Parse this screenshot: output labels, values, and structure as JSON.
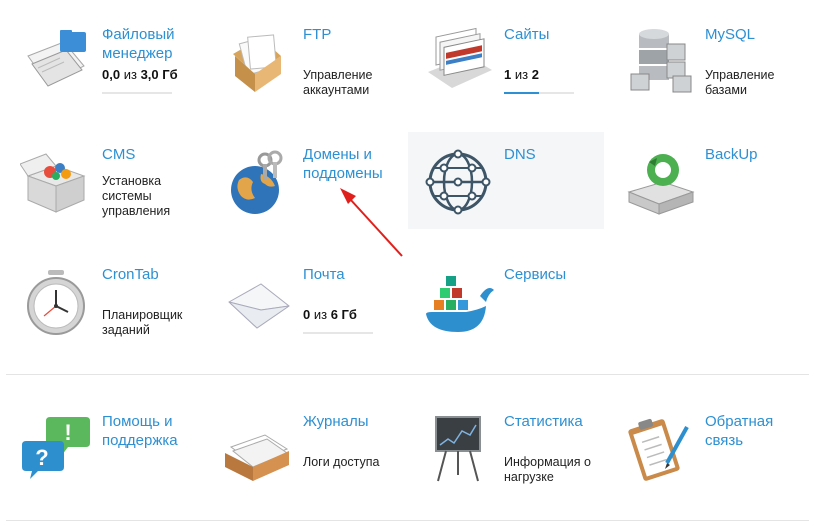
{
  "tiles": {
    "files": {
      "title": "Файловый менеджер",
      "used": "0,0",
      "sep": "из",
      "total": "3,0 Гб",
      "usage_fraction": 0.0
    },
    "ftp": {
      "title": "FTP",
      "desc": "Управление аккаунтами"
    },
    "sites": {
      "title": "Сайты",
      "used": "1",
      "sep": "из",
      "total": "2",
      "usage_fraction": 0.5
    },
    "mysql": {
      "title": "MySQL",
      "desc": "Управление базами"
    },
    "cms": {
      "title": "CMS",
      "desc": "Установка системы управления"
    },
    "domains": {
      "title": "Домены и поддомены"
    },
    "dns": {
      "title": "DNS"
    },
    "backup": {
      "title": "BackUp"
    },
    "crontab": {
      "title": "CronTab",
      "desc": "Планировщик заданий"
    },
    "mail": {
      "title": "Почта",
      "used": "0",
      "sep": "из",
      "total": "6 Гб",
      "usage_fraction": 0.0
    },
    "services": {
      "title": "Сервисы"
    },
    "help": {
      "title": "Помощь и поддержка"
    },
    "logs": {
      "title": "Журналы",
      "desc": "Логи доступа"
    },
    "stats": {
      "title": "Статистика",
      "desc": "Информация о нагрузке"
    },
    "feedback": {
      "title": "Обратная связь"
    }
  },
  "colors": {
    "link": "#2d90d2",
    "annotation_arrow": "#e0201c",
    "highlight_bg": "#f4f6f8"
  }
}
